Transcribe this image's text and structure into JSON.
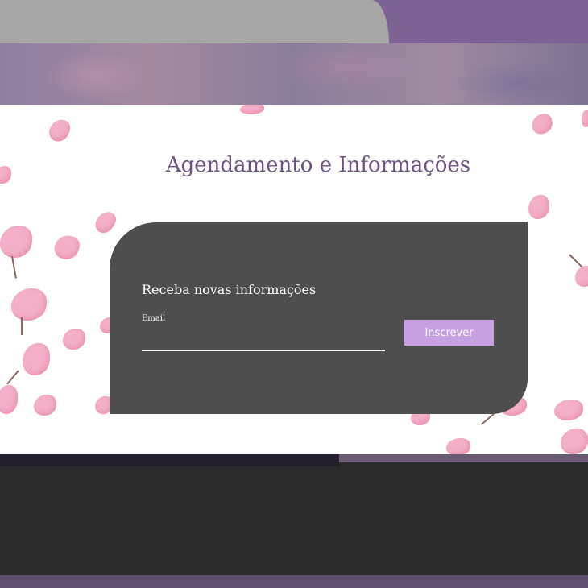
{
  "section": {
    "title": "Agendamento e Informações"
  },
  "newsletter": {
    "heading": "Receba novas informações",
    "email_label": "Email",
    "email_value": "",
    "email_placeholder": "",
    "subscribe_label": "Inscrever"
  },
  "colors": {
    "accent": "#c7a0e2",
    "title": "#6b5281",
    "card": "#4e4e4e",
    "top_bar": "#7d6495"
  }
}
